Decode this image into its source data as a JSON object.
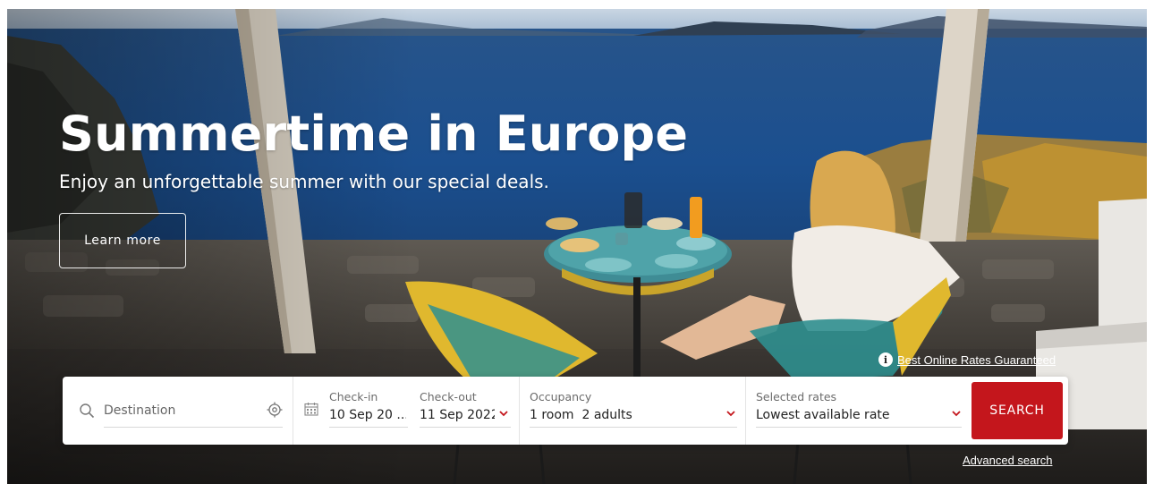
{
  "hero": {
    "title": "Summertime in Europe",
    "subtitle": "Enjoy an unforgettable summer with our special deals.",
    "cta_label": "Learn more"
  },
  "rates_note": {
    "icon": "info-icon",
    "text": "Best Online Rates Guaranteed"
  },
  "search": {
    "destination": {
      "placeholder": "Destination",
      "value": ""
    },
    "checkin": {
      "label": "Check-in",
      "value": "10 Sep 20 ..."
    },
    "checkout": {
      "label": "Check-out",
      "value": "11 Sep 2022"
    },
    "occupancy": {
      "label": "Occupancy",
      "value": "1 room  2 adults"
    },
    "rates": {
      "label": "Selected rates",
      "value": "Lowest available rate"
    },
    "button_label": "SEARCH"
  },
  "advanced_search_label": "Advanced search",
  "colors": {
    "accent": "#c4161c",
    "chevron": "#c4161c",
    "text": "#222222"
  }
}
